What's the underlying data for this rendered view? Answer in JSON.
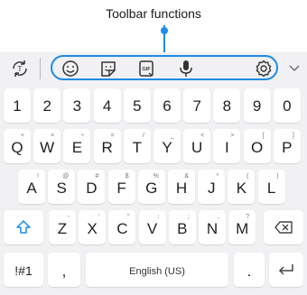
{
  "annotation": {
    "label": "Toolbar functions"
  },
  "toolbar": {
    "icons": [
      "keyboard-mode-icon",
      "emoji-icon",
      "sticker-icon",
      "gif-icon",
      "voice-input-icon",
      "settings-icon",
      "chevron-down-icon"
    ],
    "gif_text": "GIF",
    "highlight_color": "#1c8be6"
  },
  "rows": {
    "numbers": [
      "1",
      "2",
      "3",
      "4",
      "5",
      "6",
      "7",
      "8",
      "9",
      "0"
    ],
    "row1": [
      {
        "key": "Q",
        "sub": "+"
      },
      {
        "key": "W",
        "sub": "×"
      },
      {
        "key": "E",
        "sub": "÷"
      },
      {
        "key": "R",
        "sub": "="
      },
      {
        "key": "T",
        "sub": "/"
      },
      {
        "key": "Y",
        "sub": "_"
      },
      {
        "key": "U",
        "sub": "<"
      },
      {
        "key": "I",
        "sub": ">"
      },
      {
        "key": "O",
        "sub": "["
      },
      {
        "key": "P",
        "sub": "]"
      }
    ],
    "row2": [
      {
        "key": "A",
        "sub": "!"
      },
      {
        "key": "S",
        "sub": "@"
      },
      {
        "key": "D",
        "sub": "#"
      },
      {
        "key": "F",
        "sub": "$"
      },
      {
        "key": "G",
        "sub": "%"
      },
      {
        "key": "H",
        "sub": "&"
      },
      {
        "key": "J",
        "sub": "*"
      },
      {
        "key": "K",
        "sub": "("
      },
      {
        "key": "L",
        "sub": ")"
      }
    ],
    "row3": [
      {
        "key": "Z",
        "sub": "-"
      },
      {
        "key": "X",
        "sub": "'"
      },
      {
        "key": "C",
        "sub": "\""
      },
      {
        "key": "V",
        "sub": ":"
      },
      {
        "key": "B",
        "sub": ";"
      },
      {
        "key": "N",
        "sub": ","
      },
      {
        "key": "M",
        "sub": "?"
      }
    ],
    "bottom": {
      "symbols": "!#1",
      "comma": ",",
      "space": "English (US)",
      "period": "."
    }
  }
}
